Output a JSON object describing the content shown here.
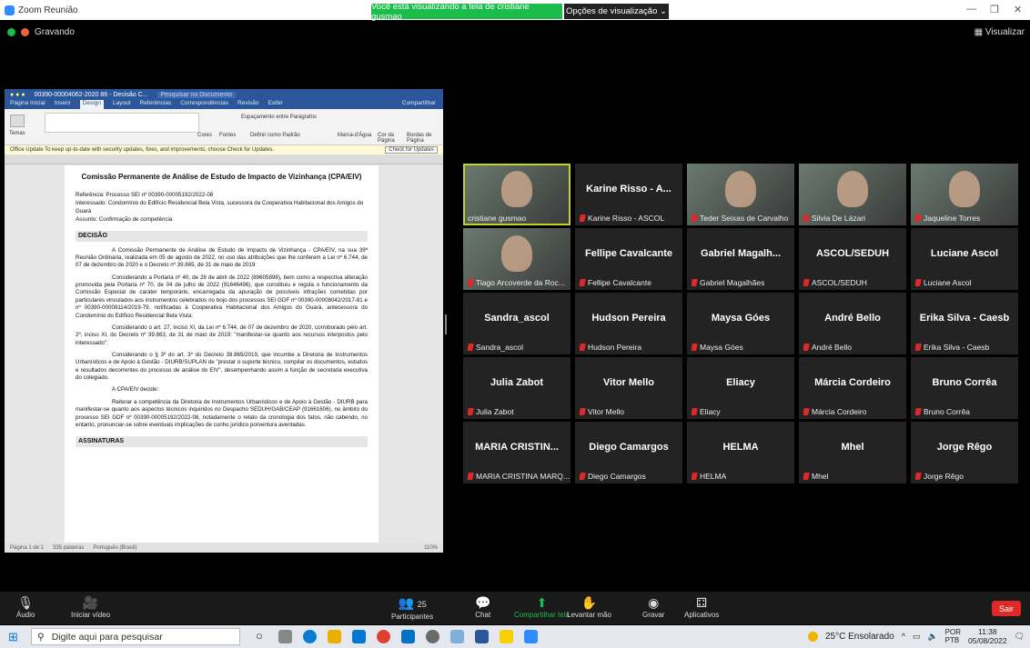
{
  "window": {
    "title": "Zoom Reunião",
    "banner": "Você está visualizando a tela de cristiane gusmao",
    "view_options": "Opções de visualização"
  },
  "recording": {
    "label": "Gravando"
  },
  "view_label": "Visualizar",
  "word": {
    "doc_title": "00390-00004062-2020 86 - Decisão C...",
    "search_placeholder": "Pesquisar no Documento",
    "tabs": [
      "Página Inicial",
      "Inserir",
      "Design",
      "Layout",
      "Referências",
      "Correspondências",
      "Revisão",
      "Exibir"
    ],
    "share": "Compartilhar",
    "ribbon": {
      "temas": "Temas",
      "cores": "Cores",
      "fontes": "Fontes",
      "espacamento": "Espaçamento entre Parágrafos",
      "padrao": "Definir como Padrão",
      "marca": "Marca-d'Água",
      "cor_pagina": "Cor da Página",
      "bordas": "Bordas de Página"
    },
    "update_msg": "Office Update To keep up-to-date with security updates, fixes, and improvements, choose Check for Updates.",
    "check_updates": "Check for Updates",
    "heading": "Comissão Permanente de Análise de Estudo de Impacto de Vizinhança (CPA/EIV)",
    "ref": "Referência: Processo SEI nº 00390-00005192/2022-08",
    "interessado": "Interessado: Condomínio do Edifício Residencial Bela Vista, sucessora da Cooperativa Habitacional dos Amigos do Guará",
    "assunto": "Assunto: Confirmação de competência",
    "sec_decisao": "DECISÃO",
    "p1": "A Comissão Permanente de Análise de Estudo de Impacto de Vizinhança - CPA/EIV, na sua 39ª Reunião Ordinária, realizada em 05 de agosto de 2022, no uso das atribuições que lhe conferem a Lei nº 6.744, de 07 de dezembro de 2020 e o Decreto nº 39.865, de 31 de maio de 2019:",
    "p2": "Considerando a Portaria nº 40, de 28 de abril de 2022 (89605898), bem como a respectiva alteração promovida pela Portaria nº 70, de 04 de julho de 2022 (91646496), que constituiu e regula o funcionamento da Comissão Especial de caráter temporário, encarregada da apuração de possíveis infrações cometidas por particulares vinculados aos instrumentos celebrados no bojo dos processos SEI GDF nº 00390-00008042/2017-81 e nº 00390-00009114/2019-79, notificadas à Cooperativa Habitacional dos Amigos do Guará, antecessora do Condomínio do Edifício Residencial Bela Vista;",
    "p3": "Considerando o art. 27, inciso XI, da Lei nº 6.744, de 07 de dezembro de 2020, corroborado pelo art. 2º, inciso XI, do Decreto nº 39.863, de 31 de maio de 2019: \"manifestar-se quanto aos recursos interpostos pelo interessado\";",
    "p4": "Considerando o § 3º do art. 3º do Decreto 39.865/2019, que incumbe a Diretoria de Instrumentos Urbanísticos e de Apoio à Gestão - DIURB/SUPLAN de \"prestar o suporte técnico, compilar os documentos, estudos e resultados decorrentes do processo de análise do EIV\", desempenhando assim a função de secretaria executiva do colegiado.",
    "p5": "A CPA/EIV decide:",
    "p6": "Reiterar a competência da Diretoria de Instrumentos Urbanísticos e de Apoio à Gestão - DIURB para manifestar-se quanto aos aspectos técnicos inquiridos no Despacho SEDUH/GAB/CEAP (91661606), no âmbito do processo SEI GDF nº 00390-00005192/2022-08, notadamente o relato da cronologia dos fatos, não cabendo, no entanto, pronunciar-se sobre eventuais implicações de cunho jurídico porventura aventadas.",
    "sec_assinaturas": "ASSINATURAS",
    "status": {
      "page": "Página 1 de 1",
      "words": "335 palavras",
      "lang": "Português (Brasil)",
      "zoom": "110%"
    }
  },
  "participants": [
    {
      "big": "",
      "label": "cristiane gusmao",
      "video": true,
      "active": true,
      "muted": false
    },
    {
      "big": "Karine Risso - A...",
      "label": "Karine Risso - ASCOL",
      "video": false,
      "muted": true
    },
    {
      "big": "",
      "label": "Teder Seixas de Carvalho",
      "video": true,
      "muted": true
    },
    {
      "big": "",
      "label": "Silvia De Lázari",
      "video": true,
      "muted": true
    },
    {
      "big": "",
      "label": "Jaqueline Torres",
      "video": true,
      "muted": true
    },
    {
      "big": "",
      "label": "Tiago Arcoverde da Roc...",
      "video": true,
      "muted": true
    },
    {
      "big": "Fellipe Cavalcante",
      "label": "Fellipe Cavalcante",
      "video": false,
      "muted": true
    },
    {
      "big": "Gabriel Magalh...",
      "label": "Gabriel Magalhães",
      "video": false,
      "muted": true
    },
    {
      "big": "ASCOL/SEDUH",
      "label": "ASCOL/SEDUH",
      "video": false,
      "muted": true
    },
    {
      "big": "Luciane Ascol",
      "label": "Luciane Ascol",
      "video": false,
      "muted": true
    },
    {
      "big": "Sandra_ascol",
      "label": "Sandra_ascol",
      "video": false,
      "muted": true
    },
    {
      "big": "Hudson Pereira",
      "label": "Hudson Pereira",
      "video": false,
      "muted": true
    },
    {
      "big": "Maysa Góes",
      "label": "Maysa Góes",
      "video": false,
      "muted": true
    },
    {
      "big": "André Bello",
      "label": "André Bello",
      "video": false,
      "muted": true
    },
    {
      "big": "Erika Silva - Caesb",
      "label": "Erika Silva - Caesb",
      "video": false,
      "muted": true
    },
    {
      "big": "Julia Zabot",
      "label": "Julia Zabot",
      "video": false,
      "muted": true
    },
    {
      "big": "Vitor Mello",
      "label": "Vitor Mello",
      "video": false,
      "muted": true
    },
    {
      "big": "Eliacy",
      "label": "Eliacy",
      "video": false,
      "muted": true
    },
    {
      "big": "Márcia Cordeiro",
      "label": "Márcia Cordeiro",
      "video": false,
      "muted": true
    },
    {
      "big": "Bruno Corrêa",
      "label": "Bruno Corrêa",
      "video": false,
      "muted": true
    },
    {
      "big": "MARIA CRISTIN...",
      "label": "MARIA CRISTINA MARQ...",
      "video": false,
      "muted": true
    },
    {
      "big": "Diego Camargos",
      "label": "Diego Camargos",
      "video": false,
      "muted": true
    },
    {
      "big": "HELMA",
      "label": "HELMA",
      "video": false,
      "muted": true
    },
    {
      "big": "Mhel",
      "label": "Mhel",
      "video": false,
      "muted": true
    },
    {
      "big": "Jorge Rêgo",
      "label": "Jorge Rêgo",
      "video": false,
      "muted": true
    }
  ],
  "toolbar": {
    "audio": "Áudio",
    "video": "Iniciar vídeo",
    "participants": "Participantes",
    "participants_count": "25",
    "chat": "Chat",
    "share": "Compartilhar tela",
    "raise": "Levantar mão",
    "record": "Gravar",
    "apps": "Aplicativos",
    "leave": "Sair"
  },
  "taskbar": {
    "search": "Digite aqui para pesquisar",
    "weather": "25°C Ensolarado",
    "lang1": "POR",
    "lang2": "PTB",
    "time": "11:38",
    "date": "05/08/2022"
  }
}
